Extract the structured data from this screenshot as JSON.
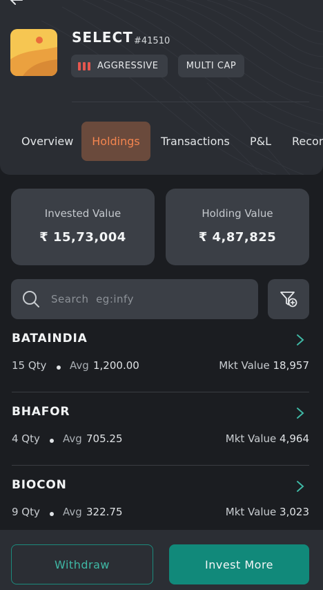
{
  "fund": {
    "name": "SELECT",
    "id": "#41510",
    "risk_label": "AGGRESSIVE",
    "category_label": "MULTI CAP"
  },
  "tabs": [
    {
      "label": "Overview",
      "active": false
    },
    {
      "label": "Holdings",
      "active": true
    },
    {
      "label": "Transactions",
      "active": false
    },
    {
      "label": "P&L",
      "active": false
    },
    {
      "label": "Recor",
      "active": false
    }
  ],
  "summary": {
    "invested_label": "Invested Value",
    "invested_value": "₹ 15,73,004",
    "holding_label": "Holding Value",
    "holding_value": "₹ 4,87,825"
  },
  "search": {
    "placeholder": "Search  eg:infy",
    "value": ""
  },
  "holdings": [
    {
      "name": "BATAINDIA",
      "qty": "15 Qty",
      "avg_label": "Avg",
      "avg": "1,200.00",
      "mkt_label": "Mkt Value",
      "mkt": "18,957"
    },
    {
      "name": "BHAFOR",
      "qty": "4 Qty",
      "avg_label": "Avg",
      "avg": "705.25",
      "mkt_label": "Mkt Value",
      "mkt": "4,964"
    },
    {
      "name": "BIOCON",
      "qty": "9 Qty",
      "avg_label": "Avg",
      "avg": "322.75",
      "mkt_label": "Mkt Value",
      "mkt": "3,023"
    }
  ],
  "actions": {
    "withdraw_label": "Withdraw",
    "invest_label": "Invest More"
  },
  "colors": {
    "background": "#1b1d21",
    "card": "#3b3f46",
    "accent_orange": "#f4854f",
    "accent_teal": "#11897a",
    "risk_red": "#e4574f"
  },
  "icons": [
    "back-arrow-icon",
    "fund-logo-desert",
    "risk-bars-icon",
    "search-icon",
    "filter-add-icon",
    "chevron-right-icon"
  ]
}
